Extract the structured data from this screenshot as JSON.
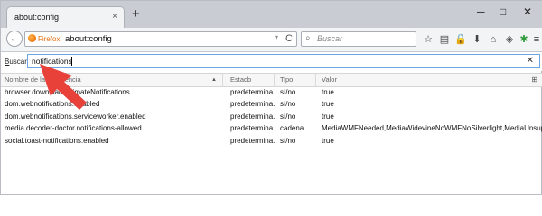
{
  "window": {
    "tab_title": "about:config",
    "tab_close": "×",
    "new_tab": "+",
    "minimize": "─",
    "maximize": "□",
    "close": "✕"
  },
  "navbar": {
    "back_icon": "←",
    "firefox_label": "Firefox",
    "url": "about:config",
    "url_dropdown": "▾",
    "reload_icon": "C",
    "search_placeholder": "Buscar",
    "search_icon": "⌕"
  },
  "toolbar_icons": [
    {
      "name": "star-icon",
      "glyph": "☆"
    },
    {
      "name": "reading-list-icon",
      "glyph": "▤"
    },
    {
      "name": "lock-icon",
      "glyph": "🔒"
    },
    {
      "name": "download-icon",
      "glyph": "⬇"
    },
    {
      "name": "home-icon",
      "glyph": "⌂"
    },
    {
      "name": "pocket-icon",
      "glyph": "◈"
    },
    {
      "name": "extension-icon",
      "glyph": "✱"
    },
    {
      "name": "menu-icon",
      "glyph": "≡"
    }
  ],
  "filter": {
    "label_prefix": "B",
    "label_rest": "uscar:",
    "value": "notifications",
    "clear_icon": "✕"
  },
  "table": {
    "columns": [
      "Nombre de la preferencia",
      "Estado",
      "Tipo",
      "Valor"
    ],
    "sort_indicator": "▲",
    "column_picker": "⊞",
    "rows": [
      {
        "name": "browser.download.animateNotifications",
        "status": "predetermina...",
        "type": "sí/no",
        "value": "true"
      },
      {
        "name": "dom.webnotifications.enabled",
        "status": "predetermina...",
        "type": "sí/no",
        "value": "true"
      },
      {
        "name": "dom.webnotifications.serviceworker.enabled",
        "status": "predetermina...",
        "type": "sí/no",
        "value": "true"
      },
      {
        "name": "media.decoder-doctor.notifications-allowed",
        "status": "predetermina...",
        "type": "cadena",
        "value": "MediaWMFNeeded,MediaWidevineNoWMFNoSilverlight,MediaUnsuppor..."
      },
      {
        "name": "social.toast-notifications.enabled",
        "status": "predetermina...",
        "type": "sí/no",
        "value": "true"
      }
    ]
  },
  "colors": {
    "accent_arrow": "#e8413a",
    "input_focus": "#6ca6e0"
  }
}
